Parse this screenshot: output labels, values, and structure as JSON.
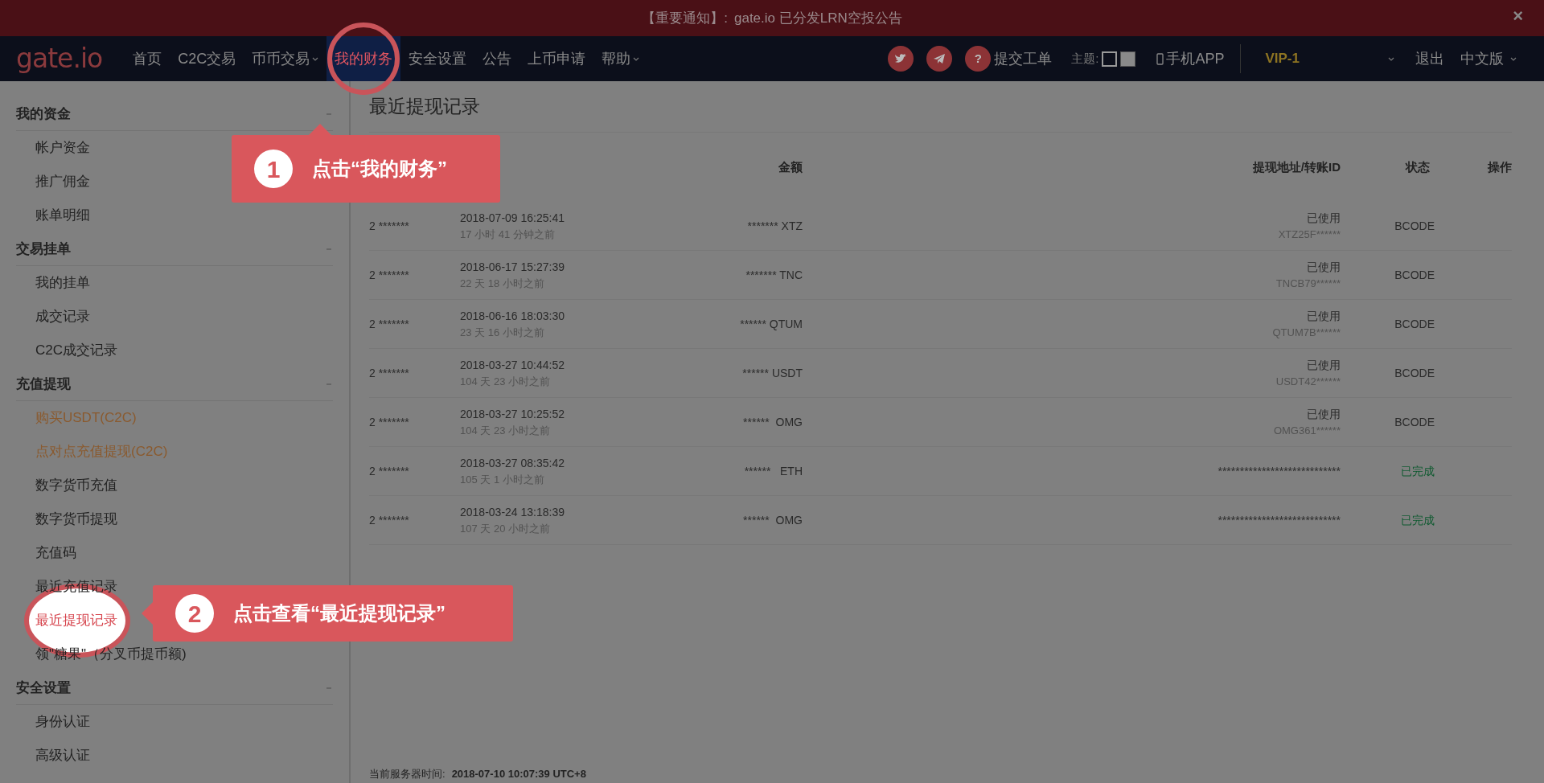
{
  "notice": {
    "label": "【重要通知】:",
    "text": "gate.io 已分发LRN空投公告",
    "close": "×"
  },
  "navbar": {
    "logo": "gate.io",
    "items": [
      {
        "label": "首页",
        "selected": false,
        "dropdown": false
      },
      {
        "label": "C2C交易",
        "selected": false,
        "dropdown": false
      },
      {
        "label": "币币交易",
        "selected": false,
        "dropdown": true
      },
      {
        "label": "我的财务",
        "selected": true,
        "dropdown": false
      },
      {
        "label": "安全设置",
        "selected": false,
        "dropdown": false
      },
      {
        "label": "公告",
        "selected": false,
        "dropdown": false
      },
      {
        "label": "上币申请",
        "selected": false,
        "dropdown": false
      },
      {
        "label": "帮助",
        "selected": false,
        "dropdown": true
      }
    ],
    "help": {
      "icon": "?",
      "label": "提交工单"
    },
    "theme": {
      "label": "主题:",
      "options": [
        {
          "selected": true
        },
        {
          "selected": false
        }
      ]
    },
    "app": "手机APP",
    "vip": "VIP-1",
    "logout": "退出",
    "language": "中文版"
  },
  "sidebar": [
    {
      "title": "我的资金",
      "expanded": true,
      "items": [
        {
          "label": "帐户资金",
          "promo": false,
          "selected": false
        },
        {
          "label": "推广佣金",
          "promo": false,
          "selected": false
        },
        {
          "label": "账单明细",
          "promo": false,
          "selected": false
        }
      ]
    },
    {
      "title": "交易挂单",
      "expanded": true,
      "items": [
        {
          "label": "我的挂单",
          "promo": false,
          "selected": false
        },
        {
          "label": "成交记录",
          "promo": false,
          "selected": false
        },
        {
          "label": "C2C成交记录",
          "promo": false,
          "selected": false
        }
      ]
    },
    {
      "title": "充值提现",
      "expanded": true,
      "items": [
        {
          "label": "购买USDT(C2C)",
          "promo": true,
          "selected": false
        },
        {
          "label": "点对点充值提现(C2C)",
          "promo": true,
          "selected": false
        },
        {
          "label": "数字货币充值",
          "promo": false,
          "selected": false
        },
        {
          "label": "数字货币提现",
          "promo": false,
          "selected": false
        },
        {
          "label": "充值码",
          "promo": false,
          "selected": false
        },
        {
          "label": "最近充值记录",
          "promo": false,
          "selected": false
        },
        {
          "label": "最近提现记录",
          "promo": false,
          "selected": true
        },
        {
          "label": "领\"糖果\"（分叉币提币额)",
          "promo": false,
          "selected": false
        }
      ]
    },
    {
      "title": "安全设置",
      "expanded": true,
      "items": [
        {
          "label": "身份认证",
          "promo": false,
          "selected": false
        },
        {
          "label": "高级认证",
          "promo": false,
          "selected": false
        }
      ]
    }
  ],
  "content": {
    "title": "最近提现记录",
    "columns": [
      "金额",
      "提现地址/转账ID",
      "状态",
      "操作"
    ],
    "rows": [
      {
        "column_1": "2 *******",
        "date": "2018-07-09 16:25:41",
        "ago": "17 小时 41 分钟之前",
        "amount": "******* XTZ",
        "address_status": "已使用",
        "address": "XTZ25F******",
        "status": "BCODE",
        "completed": false
      },
      {
        "column_1": "2 *******",
        "date": "2018-06-17 15:27:39",
        "ago": "22 天 18 小时之前",
        "amount": "******* TNC",
        "address_status": "已使用",
        "address": "TNCB79******",
        "status": "BCODE",
        "completed": false
      },
      {
        "column_1": "2 *******",
        "date": "2018-06-16 18:03:30",
        "ago": "23 天 16 小时之前",
        "amount": "****** QTUM",
        "address_status": "已使用",
        "address": "QTUM7B******",
        "status": "BCODE",
        "completed": false
      },
      {
        "column_1": "2 *******",
        "date": "2018-03-27 10:44:52",
        "ago": "104 天 23 小时之前",
        "amount": "****** USDT",
        "address_status": "已使用",
        "address": "USDT42******",
        "status": "BCODE",
        "completed": false
      },
      {
        "column_1": "2 *******",
        "date": "2018-03-27 10:25:52",
        "ago": "104 天 23 小时之前",
        "amount": "******  OMG",
        "address_status": "已使用",
        "address": "OMG361******",
        "status": "BCODE",
        "completed": false
      },
      {
        "column_1": "2 *******",
        "date": "2018-03-27 08:35:42",
        "ago": "105 天 1 小时之前",
        "amount": "******   ETH",
        "address": "****************************",
        "status": "已完成",
        "completed": true
      },
      {
        "column_1": "2 *******",
        "date": "2018-03-24 13:18:39",
        "ago": "107 天 20 小时之前",
        "amount": "******  OMG",
        "address": "****************************",
        "status": "已完成",
        "completed": true
      }
    ],
    "server_time_label": "当前服务器时间:",
    "server_time": "2018-07-10 10:07:39 UTC+8"
  },
  "callouts": [
    {
      "step": "1",
      "text": "点击“我的财务”"
    },
    {
      "step": "2",
      "text": "点击查看“最近提现记录”"
    }
  ]
}
